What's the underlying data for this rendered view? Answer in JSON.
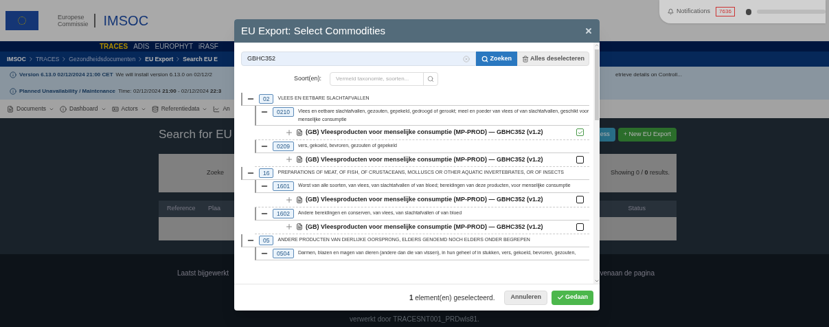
{
  "header": {
    "org_line1": "Europese",
    "org_line2": "Commissie",
    "app_name": "IMSOC",
    "notifications_label": "Notifications",
    "notifications_count": "7636"
  },
  "nav": [
    {
      "label": "TRACES",
      "selected": true
    },
    {
      "label": "ADIS",
      "selected": false
    },
    {
      "label": "EUROPHYT",
      "selected": false
    },
    {
      "label": "iRASF",
      "selected": false
    }
  ],
  "breadcrumb": [
    {
      "label": "IMSOC",
      "emphasized": true
    },
    {
      "label": "TRACES",
      "emphasized": false
    },
    {
      "label": "Gezondheidsdocumenten",
      "emphasized": false
    },
    {
      "label": "EU Export",
      "emphasized": true
    },
    {
      "label": "Search EU E",
      "emphasized": true
    }
  ],
  "alerts": [
    {
      "title": "Version 6.13.0 02/12/2024 21:00 CET",
      "text": "We will install version 6.13.0 on 02/12/2",
      "text_right": "etrieve details on Controll..."
    },
    {
      "title": "Planned Unavailability / Maintenance",
      "text": "Time: 02/12/2024 **21:00** - 02/12/2024 **22:3**"
    }
  ],
  "menu": [
    "Documents",
    "Dashboard",
    "Actors",
    "Referentiedata",
    "An"
  ],
  "main": {
    "title": "Search for EU",
    "button_1": "ess",
    "new_button": "+ New EU Export",
    "search_label": "Zoeke",
    "results": "Showing 0 / **0** results.",
    "columns": [
      "Reference",
      "Plaa",
      "Status"
    ]
  },
  "footer": {
    "left": "Laatst bijgewerkt",
    "right": "venaan de pagina",
    "processed": "verwerkt door TRACESNT001_PRDwls81."
  },
  "modal": {
    "title": "EU Export: Select Commodities",
    "search_value": "GBHC352",
    "search_button": "Zoeken",
    "deselect_button": "Alles deselecteren",
    "species_label": "Soort(en):",
    "species_placeholder": "Vermeld taxonomie, soorten...",
    "tree": [
      {
        "code": "02",
        "label": "VLEES EN EETBARE SLACHTAFVALLEN",
        "expanded": true,
        "children": [
          {
            "code": "0210",
            "label": "Vlees en eetbare slachtafvallen, gezouten, gepekeld, gedroogd of gerookt; meel en poeder van vlees of van slachtafvallen, geschikt voor menselijke consumptie",
            "expanded": true,
            "children": [
              {
                "label": "(GB) Vleesproducten voor menselijke consumptie (MP-PROD) — GBHC352 (v1.2)",
                "expanded": false,
                "checked": true
              }
            ]
          },
          {
            "code": "0209",
            "label": "vers, gekoeld, bevroren, gezouten of gepekeld",
            "expanded": true,
            "children": [
              {
                "label": "(GB) Vleesproducten voor menselijke consumptie (MP-PROD) — GBHC352 (v1.2)",
                "expanded": false,
                "checked": false
              }
            ]
          }
        ]
      },
      {
        "code": "16",
        "label": "PREPARATIONS OF MEAT, OF FISH, OF CRUSTACEANS, MOLLUSCS OR OTHER AQUATIC INVERTEBRATES, OR OF INSECTS",
        "expanded": true,
        "children": [
          {
            "code": "1601",
            "label": "Worst van alle soorten, van vlees, van slachtafvallen of van bloed; bereidingen van deze producten, voor menselijke consumptie",
            "expanded": true,
            "children": [
              {
                "label": "(GB) Vleesproducten voor menselijke consumptie (MP-PROD) — GBHC352 (v1.2)",
                "expanded": false,
                "checked": false
              }
            ]
          },
          {
            "code": "1602",
            "label": "Andere bereidingen en conserven, van vlees, van slachtafvallen of van bloed",
            "expanded": true,
            "children": [
              {
                "label": "(GB) Vleesproducten voor menselijke consumptie (MP-PROD) — GBHC352 (v1.2)",
                "expanded": false,
                "checked": false
              }
            ]
          }
        ]
      },
      {
        "code": "05",
        "label": "ANDERE PRODUCTEN VAN DIERLIJKE OORSPRONG, ELDERS GENOEMD NOCH ELDERS ONDER BEGREPEN",
        "expanded": true,
        "children": [
          {
            "code": "0504",
            "label": "Darmen, blazen en magen van dieren (andere dan die van vissen), in hun geheel of in stukken, vers, gekoeld, bevroren, gezouten,",
            "expanded": true
          }
        ]
      }
    ],
    "selection_count": "**1** element(en) geselecteerd.",
    "cancel_button": "Annuleren",
    "done_button": "Gedaan"
  }
}
